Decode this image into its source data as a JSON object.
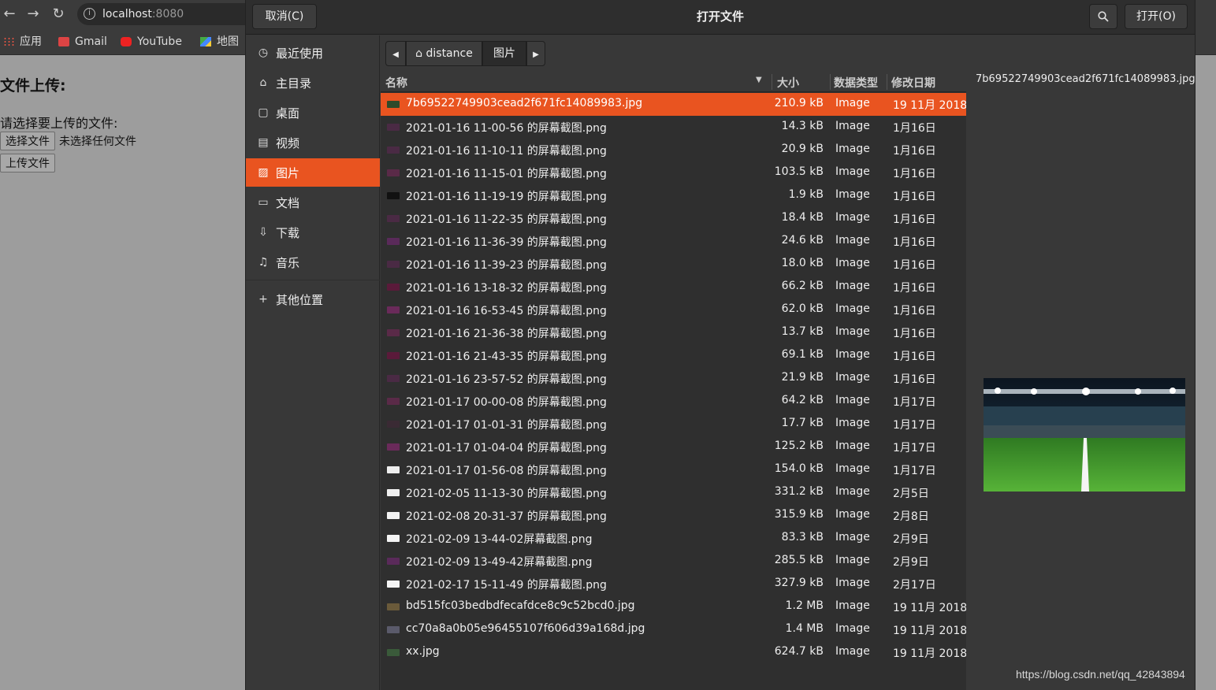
{
  "browser": {
    "url_host": "localhost",
    "url_port": ":8080",
    "bookmarks": [
      {
        "label": "应用",
        "icon": "apps-icon"
      },
      {
        "label": "Gmail",
        "icon": "gmail-icon"
      },
      {
        "label": "YouTube",
        "icon": "youtube-icon"
      },
      {
        "label": "地图",
        "icon": "maps-icon"
      }
    ]
  },
  "page": {
    "heading": "文件上传:",
    "prompt": "请选择要上传的文件:",
    "choose_label": "选择文件",
    "no_file_label": "未选择任何文件",
    "upload_label": "上传文件"
  },
  "dialog": {
    "title": "打开文件",
    "cancel_label": "取消(C)",
    "open_label": "打开(O)",
    "search_icon": "search-icon",
    "sidebar": [
      {
        "label": "最近使用",
        "icon": "clock-icon",
        "active": false
      },
      {
        "label": "主目录",
        "icon": "home-icon",
        "active": false
      },
      {
        "label": "桌面",
        "icon": "desktop-icon",
        "active": false
      },
      {
        "label": "视频",
        "icon": "film-icon",
        "active": false
      },
      {
        "label": "图片",
        "icon": "image-icon",
        "active": true
      },
      {
        "label": "文档",
        "icon": "document-icon",
        "active": false
      },
      {
        "label": "下载",
        "icon": "download-icon",
        "active": false
      },
      {
        "label": "音乐",
        "icon": "music-icon",
        "active": false
      }
    ],
    "other_locations": "其他位置",
    "path": {
      "home_segment": "distance",
      "current_segment": "图片"
    },
    "columns": {
      "name": "名称",
      "size": "大小",
      "type": "数据类型",
      "modified": "修改日期"
    },
    "files": [
      {
        "name": "7b69522749903cead2f671fc14089983.jpg",
        "size": "210.9 kB",
        "type": "Image",
        "date": "19 11月 2018",
        "selected": true,
        "thumb": "#2e4a2a"
      },
      {
        "name": "2021-01-16 11-00-56 的屏幕截图.png",
        "size": "14.3 kB",
        "type": "Image",
        "date": "1月16日",
        "selected": false,
        "thumb": "#4a2a44"
      },
      {
        "name": "2021-01-16 11-10-11 的屏幕截图.png",
        "size": "20.9 kB",
        "type": "Image",
        "date": "1月16日",
        "selected": false,
        "thumb": "#4a2a44"
      },
      {
        "name": "2021-01-16 11-15-01 的屏幕截图.png",
        "size": "103.5 kB",
        "type": "Image",
        "date": "1月16日",
        "selected": false,
        "thumb": "#5a2a48"
      },
      {
        "name": "2021-01-16 11-19-19 的屏幕截图.png",
        "size": "1.9 kB",
        "type": "Image",
        "date": "1月16日",
        "selected": false,
        "thumb": "#111111"
      },
      {
        "name": "2021-01-16 11-22-35 的屏幕截图.png",
        "size": "18.4 kB",
        "type": "Image",
        "date": "1月16日",
        "selected": false,
        "thumb": "#4a2a44"
      },
      {
        "name": "2021-01-16 11-36-39 的屏幕截图.png",
        "size": "24.6 kB",
        "type": "Image",
        "date": "1月16日",
        "selected": false,
        "thumb": "#5a2a5a"
      },
      {
        "name": "2021-01-16 11-39-23 的屏幕截图.png",
        "size": "18.0 kB",
        "type": "Image",
        "date": "1月16日",
        "selected": false,
        "thumb": "#4a2a44"
      },
      {
        "name": "2021-01-16 13-18-32 的屏幕截图.png",
        "size": "66.2 kB",
        "type": "Image",
        "date": "1月16日",
        "selected": false,
        "thumb": "#5a1a3a"
      },
      {
        "name": "2021-01-16 16-53-45 的屏幕截图.png",
        "size": "62.0 kB",
        "type": "Image",
        "date": "1月16日",
        "selected": false,
        "thumb": "#6a2a5a"
      },
      {
        "name": "2021-01-16 21-36-38 的屏幕截图.png",
        "size": "13.7 kB",
        "type": "Image",
        "date": "1月16日",
        "selected": false,
        "thumb": "#5a2a48"
      },
      {
        "name": "2021-01-16 21-43-35 的屏幕截图.png",
        "size": "69.1 kB",
        "type": "Image",
        "date": "1月16日",
        "selected": false,
        "thumb": "#5a1a3a"
      },
      {
        "name": "2021-01-16 23-57-52 的屏幕截图.png",
        "size": "21.9 kB",
        "type": "Image",
        "date": "1月16日",
        "selected": false,
        "thumb": "#4a2a44"
      },
      {
        "name": "2021-01-17 00-00-08 的屏幕截图.png",
        "size": "64.2 kB",
        "type": "Image",
        "date": "1月17日",
        "selected": false,
        "thumb": "#5a2a48"
      },
      {
        "name": "2021-01-17 01-01-31 的屏幕截图.png",
        "size": "17.7 kB",
        "type": "Image",
        "date": "1月17日",
        "selected": false,
        "thumb": "#3a2a34"
      },
      {
        "name": "2021-01-17 01-04-04 的屏幕截图.png",
        "size": "125.2 kB",
        "type": "Image",
        "date": "1月17日",
        "selected": false,
        "thumb": "#6a2a5a"
      },
      {
        "name": "2021-01-17 01-56-08 的屏幕截图.png",
        "size": "154.0 kB",
        "type": "Image",
        "date": "1月17日",
        "selected": false,
        "thumb": "#eeeeee"
      },
      {
        "name": "2021-02-05 11-13-30 的屏幕截图.png",
        "size": "331.2 kB",
        "type": "Image",
        "date": "2月5日",
        "selected": false,
        "thumb": "#f0f0f0"
      },
      {
        "name": "2021-02-08 20-31-37 的屏幕截图.png",
        "size": "315.9 kB",
        "type": "Image",
        "date": "2月8日",
        "selected": false,
        "thumb": "#f2f2f2"
      },
      {
        "name": "2021-02-09 13-44-02屏幕截图.png",
        "size": "83.3 kB",
        "type": "Image",
        "date": "2月9日",
        "selected": false,
        "thumb": "#f4f4f4"
      },
      {
        "name": "2021-02-09 13-49-42屏幕截图.png",
        "size": "285.5 kB",
        "type": "Image",
        "date": "2月9日",
        "selected": false,
        "thumb": "#5a2a5a"
      },
      {
        "name": "2021-02-17 15-11-49 的屏幕截图.png",
        "size": "327.9 kB",
        "type": "Image",
        "date": "2月17日",
        "selected": false,
        "thumb": "#f4f4f4"
      },
      {
        "name": "bd515fc03bedbdfecafdce8c9c52bcd0.jpg",
        "size": "1.2 MB",
        "type": "Image",
        "date": "19 11月 2018",
        "selected": false,
        "thumb": "#6a5a3a"
      },
      {
        "name": "cc70a8a0b05e96455107f606d39a168d.jpg",
        "size": "1.4 MB",
        "type": "Image",
        "date": "19 11月 2018",
        "selected": false,
        "thumb": "#5a5a6a"
      },
      {
        "name": "xx.jpg",
        "size": "624.7 kB",
        "type": "Image",
        "date": "19 11月 2018",
        "selected": false,
        "thumb": "#3a5a3a"
      }
    ],
    "preview_name": "7b69522749903cead2f671fc14089983.jpg"
  },
  "watermark": "https://blog.csdn.net/qq_42843894"
}
